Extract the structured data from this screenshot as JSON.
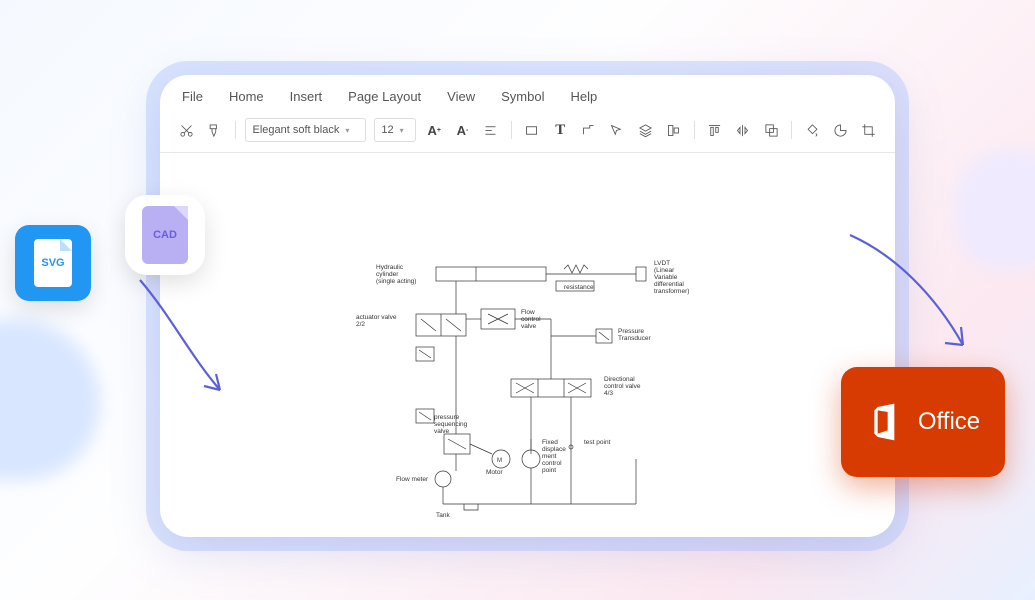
{
  "menu": [
    "File",
    "Home",
    "Insert",
    "Page Layout",
    "View",
    "Symbol",
    "Help"
  ],
  "toolbar": {
    "font": "Elegant soft black",
    "size": "12"
  },
  "input_badges": {
    "svg": "SVG",
    "cad": "CAD"
  },
  "output_badge": "Office",
  "diagram": {
    "labels": {
      "hydraulic": "Hydraulic cylinder (single acting)",
      "lvdt": "LVDT (Linear Variable differential transformer)",
      "resistance": "resistance",
      "actuator": "actuator valve 2/2",
      "flowvalve": "Flow control valve",
      "pressure_trans": "Pressure Transducer",
      "directional": "Directional control valve 4/3",
      "pressure_seq": "pressure sequencing valve",
      "motor": "Motor",
      "displacement": "Fixed displacement control point",
      "testpoint": "test point",
      "flowmeter": "Flow meter",
      "tank": "Tank"
    }
  }
}
